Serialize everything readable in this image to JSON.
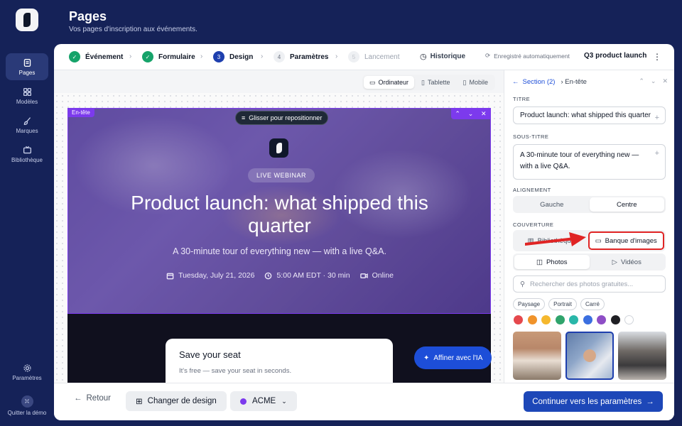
{
  "header": {
    "title": "Pages",
    "subtitle": "Vos pages d'inscription aux événements."
  },
  "sidebar": {
    "items": [
      {
        "label": "Pages",
        "icon": "pages-icon",
        "active": true
      },
      {
        "label": "Modèles",
        "icon": "grid-icon",
        "active": false
      },
      {
        "label": "Marques",
        "icon": "brush-icon",
        "active": false
      },
      {
        "label": "Bibliothèque",
        "icon": "tv-icon",
        "active": false
      }
    ],
    "bottom": [
      {
        "label": "Paramètres",
        "icon": "gear-icon"
      },
      {
        "label": "Quitter la démo",
        "icon": "exit-icon"
      }
    ]
  },
  "stepper": {
    "steps": [
      {
        "num": "1",
        "label": "Événement",
        "state": "done"
      },
      {
        "num": "2",
        "label": "Formulaire",
        "state": "done"
      },
      {
        "num": "3",
        "label": "Design",
        "state": "current"
      },
      {
        "num": "4",
        "label": "Paramètres",
        "state": "todo"
      },
      {
        "num": "5",
        "label": "Lancement",
        "state": "disabled"
      }
    ],
    "history_label": "Historique",
    "autosave_label": "Enregistré automatiquement",
    "page_name": "Q3 product launch"
  },
  "devices": [
    {
      "label": "Ordinateur",
      "active": true
    },
    {
      "label": "Tablette",
      "active": false
    },
    {
      "label": "Mobile",
      "active": false
    }
  ],
  "hero": {
    "section_tag": "En-tête",
    "drag_label": "Glisser pour repositionner",
    "badge": "LIVE WEBINAR",
    "title": "Product launch: what shipped this quarter",
    "subtitle": "A 30-minute tour of everything new — with a live Q&A.",
    "date": "Tuesday, July 21, 2026",
    "time": "5:00 AM EDT · 30 min",
    "location": "Online"
  },
  "form_card": {
    "title": "Save your seat",
    "subtitle": "It's free — save your seat in seconds."
  },
  "ai_button": "Affiner avec l'IA",
  "footer": {
    "back_label": "Retour",
    "design_label": "Changer de design",
    "brand_label": "ACME",
    "continue_label": "Continuer vers les paramètres"
  },
  "panel": {
    "back_link": "Section (2)",
    "current": "En-tête",
    "title_label": "TITRE",
    "title_value": "Product launch: what shipped this quarter",
    "subtitle_label": "SOUS-TITRE",
    "subtitle_value": "A 30-minute tour of everything new — with a live Q&A.",
    "align_label": "ALIGNEMENT",
    "align_options": [
      "Gauche",
      "Centre"
    ],
    "align_selected": "Centre",
    "cover_label": "COUVERTURE",
    "cover_sources": [
      "Bibliothèque",
      "Banque d'images"
    ],
    "media_types": [
      "Photos",
      "Vidéos"
    ],
    "search_placeholder": "Rechercher des photos gratuites...",
    "orientations": [
      "Paysage",
      "Portrait",
      "Carré"
    ],
    "colors": [
      "#e5484d",
      "#f0932b",
      "#f5b82e",
      "#30a46c",
      "#2ab7a9",
      "#3b6fe0",
      "#8e4ec6",
      "#1f1f24",
      "#ffffff"
    ]
  }
}
